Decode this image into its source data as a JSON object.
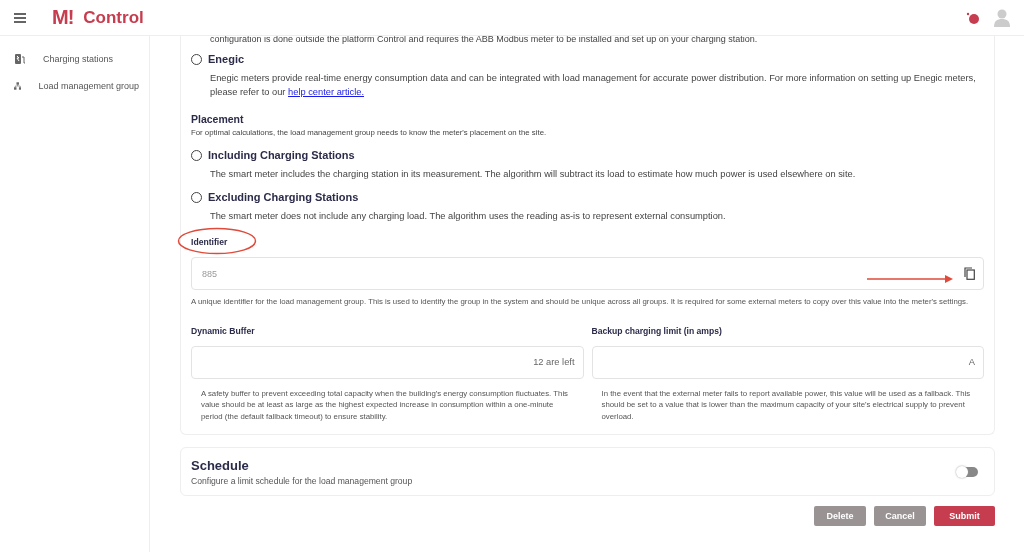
{
  "header": {
    "brand_mark": "M!",
    "brand": "Control",
    "notification": true
  },
  "sidebar": {
    "items": [
      {
        "label": "Charging stations",
        "kind": "station",
        "selected": false
      },
      {
        "label": "Load management group",
        "kind": "hierarchy",
        "selected": false
      }
    ]
  },
  "meter": {
    "cut_text": "configuration is done outside the platform Control and requires the ABB Modbus meter to be installed and set up on your charging station.",
    "options": [
      {
        "label": "Enegic",
        "selected": false,
        "description": "Enegic meters provide real-time energy consumption data and can be integrated with load management for accurate power distribution. For more information on setting up Enegic meters, please refer to our ",
        "link": "help center article."
      }
    ]
  },
  "placement": {
    "title": "Placement",
    "description": "For optimal calculations, the load management group needs to know the meter's placement on the site.",
    "options": [
      {
        "label": "Including Charging Stations",
        "selected": false,
        "description": "The smart meter includes the charging station in its measurement. The algorithm will subtract its load to estimate how much power is used elsewhere on site."
      },
      {
        "label": "Excluding Charging Stations",
        "selected": false,
        "description": "The smart meter does not include any charging load. The algorithm uses the reading as-is to represent external consumption."
      }
    ]
  },
  "identifier": {
    "label": "Identifier",
    "value": "885",
    "help": "A unique identifier for the load management group. This is used to identify the group in the system and should be unique across all groups. It is required for some external meters to copy over this value into the meter's settings."
  },
  "fields": [
    {
      "label": "Dynamic Buffer",
      "suffix": "12 are left",
      "help": "A safety buffer to prevent exceeding total capacity when the building's energy consumption fluctuates. This value should be at least as large as the highest expected increase in consumption within a one-minute period (the default fallback timeout) to ensure stability."
    },
    {
      "label": "Backup charging limit (in amps)",
      "suffix": "A",
      "help": "In the event that the external meter fails to report available power, this value will be used as a fallback. This should be set to a value that is lower than the maximum capacity of your site's electrical supply to prevent overload."
    }
  ],
  "schedule": {
    "title": "Schedule",
    "description": "Configure a limit schedule for the load management group",
    "on": false
  },
  "buttons": [
    {
      "label": "Delete",
      "disabled": true
    },
    {
      "label": "Cancel",
      "disabled": true
    },
    {
      "label": "Submit",
      "disabled": false
    }
  ]
}
